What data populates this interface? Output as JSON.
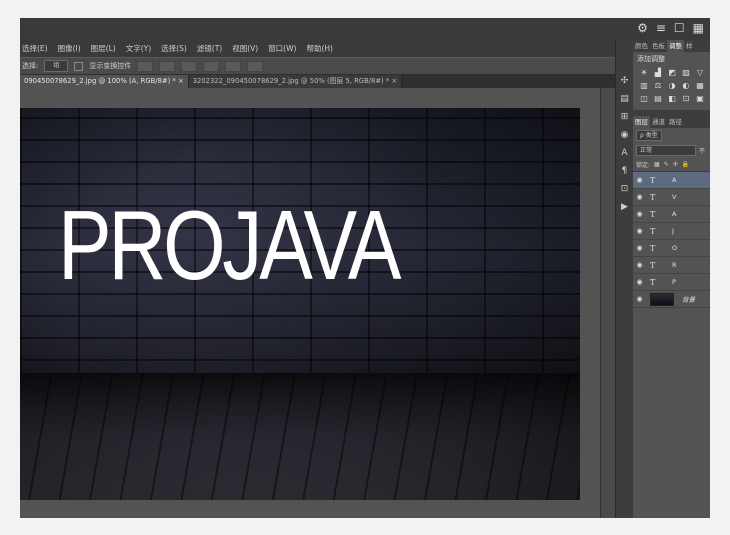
{
  "top_icons": [
    "⚙",
    "≡",
    "☐",
    "▦"
  ],
  "menu": [
    "选择(E)",
    "图像(I)",
    "图层(L)",
    "文字(Y)",
    "选择(S)",
    "滤镜(T)",
    "视图(V)",
    "窗口(W)",
    "帮助(H)"
  ],
  "options": {
    "label": "选择:",
    "select_value": "组",
    "checkbox_label": "显示变换控件"
  },
  "tabs": [
    "090450078629_2.jpg @ 100% (A, RGB/8#) *",
    "3202322_090450078629_2.jpg @ 50% (图层 5, RGB/8#) *"
  ],
  "tab_close": "×",
  "artwork": {
    "text": "PROJAVA"
  },
  "panels": {
    "top_tabs": [
      "颜色",
      "色板",
      "调整",
      "样"
    ],
    "adjust_title": "添加调整",
    "adjust_icons": [
      "☀",
      "▟",
      "◩",
      "▨",
      "▽",
      "▥",
      "⚖",
      "◑",
      "◐",
      "▦",
      "◫",
      "▤",
      "◧",
      "⊡",
      "▣"
    ],
    "layer_tabs": [
      "图层",
      "通道",
      "路径"
    ],
    "filter_kind": "ρ 类型",
    "blend_mode": "正常",
    "opacity_label": "不",
    "lock_label": "锁定:",
    "layers": [
      {
        "type": "text",
        "name": "A"
      },
      {
        "type": "text",
        "name": "V"
      },
      {
        "type": "text",
        "name": "A"
      },
      {
        "type": "text",
        "name": "J"
      },
      {
        "type": "text",
        "name": "O"
      },
      {
        "type": "text",
        "name": "R"
      },
      {
        "type": "text",
        "name": "P"
      },
      {
        "type": "image",
        "name": "背景"
      }
    ]
  },
  "tool_icons": [
    "✣",
    "▤",
    "⊞",
    "◉",
    "A",
    "¶",
    "⊡",
    "▶"
  ]
}
